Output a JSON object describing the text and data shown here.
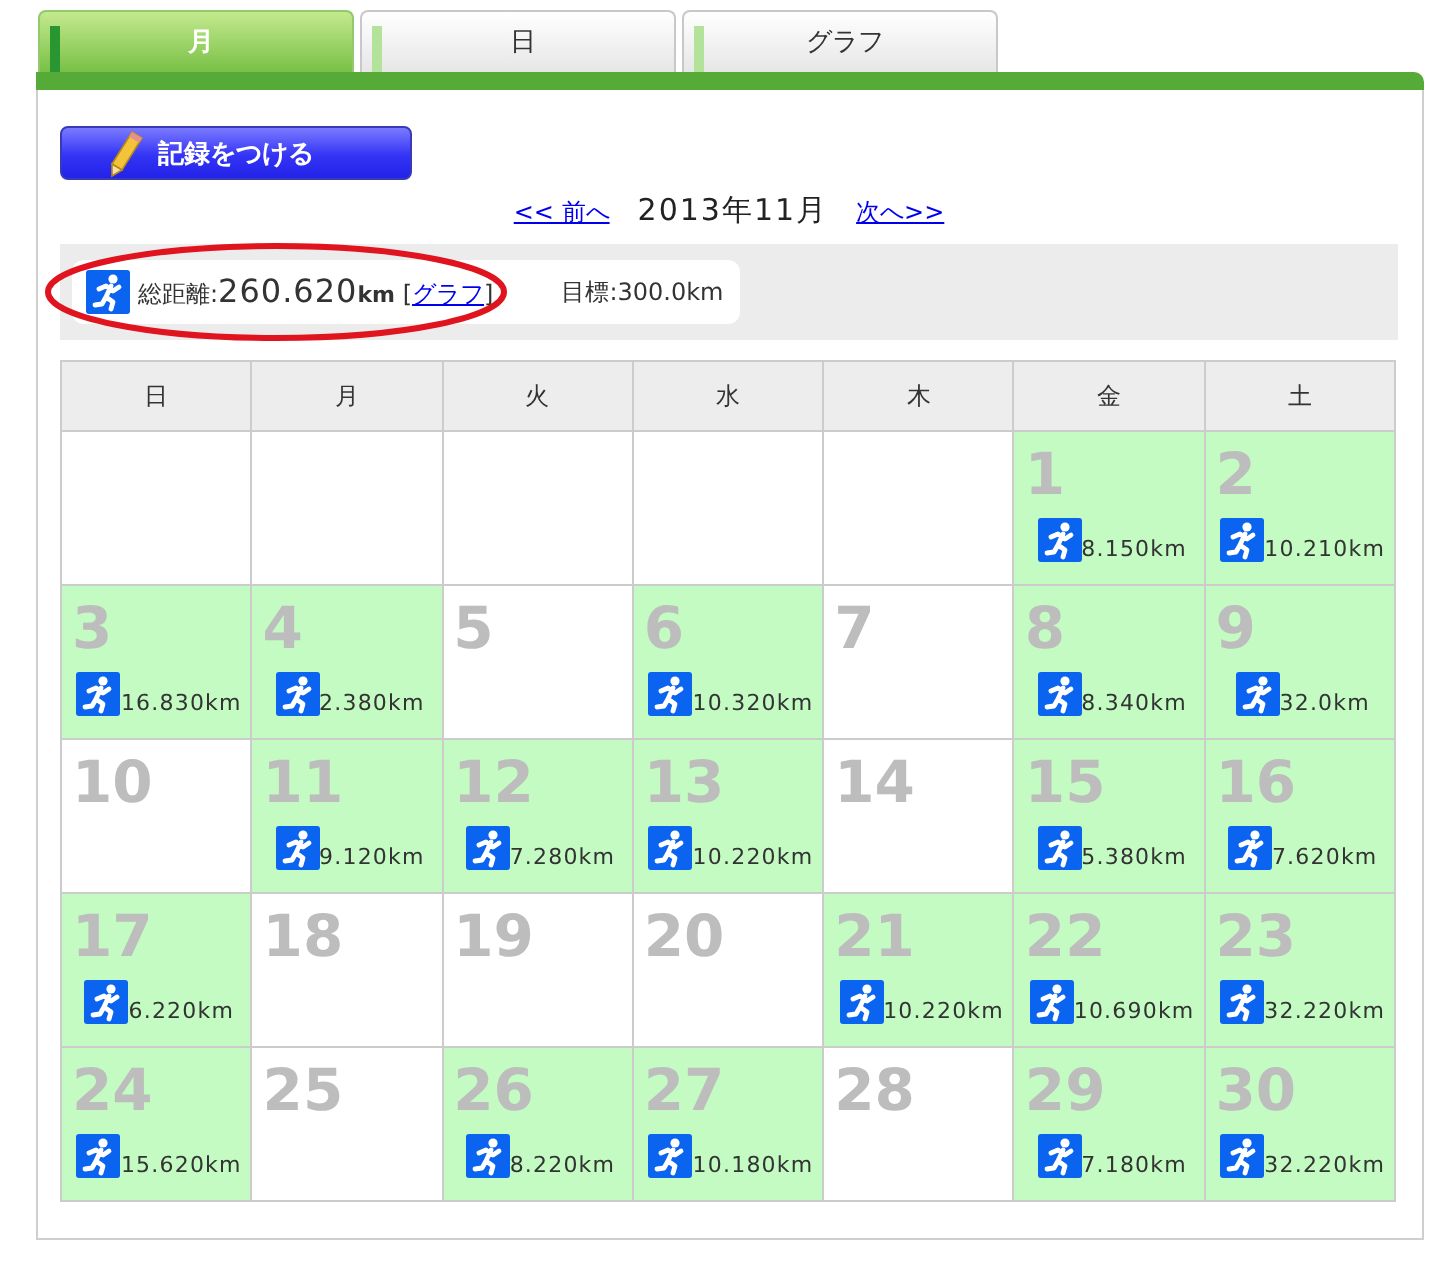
{
  "tabs": [
    {
      "label": "月",
      "selected": true
    },
    {
      "label": "日",
      "selected": false
    },
    {
      "label": "グラフ",
      "selected": false
    }
  ],
  "record_button": {
    "label": "記録をつける"
  },
  "month_nav": {
    "prev": "<< 前へ",
    "title": "2013年11月",
    "next": "次へ>>"
  },
  "summary": {
    "label": "総距離:",
    "total": "260.620",
    "unit": "km",
    "link_open": "[",
    "link": "グラフ",
    "link_close": "]",
    "goal": "目標:300.0km"
  },
  "calendar": {
    "weekdays": [
      "日",
      "月",
      "火",
      "水",
      "木",
      "金",
      "土"
    ],
    "weeks": [
      [
        {
          "kind": "blank"
        },
        {
          "kind": "blank"
        },
        {
          "kind": "blank"
        },
        {
          "kind": "blank"
        },
        {
          "kind": "blank"
        },
        {
          "kind": "run",
          "day": "1",
          "distance": "8.150km"
        },
        {
          "kind": "run",
          "day": "2",
          "distance": "10.210km"
        }
      ],
      [
        {
          "kind": "run",
          "day": "3",
          "distance": "16.830km"
        },
        {
          "kind": "run",
          "day": "4",
          "distance": "2.380km"
        },
        {
          "kind": "rest",
          "day": "5"
        },
        {
          "kind": "run",
          "day": "6",
          "distance": "10.320km"
        },
        {
          "kind": "rest",
          "day": "7"
        },
        {
          "kind": "run",
          "day": "8",
          "distance": "8.340km"
        },
        {
          "kind": "run",
          "day": "9",
          "distance": "32.0km"
        }
      ],
      [
        {
          "kind": "rest",
          "day": "10"
        },
        {
          "kind": "run",
          "day": "11",
          "distance": "9.120km"
        },
        {
          "kind": "run",
          "day": "12",
          "distance": "7.280km"
        },
        {
          "kind": "run",
          "day": "13",
          "distance": "10.220km"
        },
        {
          "kind": "rest",
          "day": "14"
        },
        {
          "kind": "run",
          "day": "15",
          "distance": "5.380km"
        },
        {
          "kind": "run",
          "day": "16",
          "distance": "7.620km"
        }
      ],
      [
        {
          "kind": "run",
          "day": "17",
          "distance": "6.220km"
        },
        {
          "kind": "rest",
          "day": "18"
        },
        {
          "kind": "rest",
          "day": "19"
        },
        {
          "kind": "rest",
          "day": "20"
        },
        {
          "kind": "run",
          "day": "21",
          "distance": "10.220km"
        },
        {
          "kind": "run",
          "day": "22",
          "distance": "10.690km"
        },
        {
          "kind": "run",
          "day": "23",
          "distance": "32.220km"
        }
      ],
      [
        {
          "kind": "run",
          "day": "24",
          "distance": "15.620km"
        },
        {
          "kind": "rest",
          "day": "25"
        },
        {
          "kind": "run",
          "day": "26",
          "distance": "8.220km"
        },
        {
          "kind": "run",
          "day": "27",
          "distance": "10.180km"
        },
        {
          "kind": "rest",
          "day": "28"
        },
        {
          "kind": "run",
          "day": "29",
          "distance": "7.180km"
        },
        {
          "kind": "run",
          "day": "30",
          "distance": "32.220km"
        }
      ]
    ]
  }
}
